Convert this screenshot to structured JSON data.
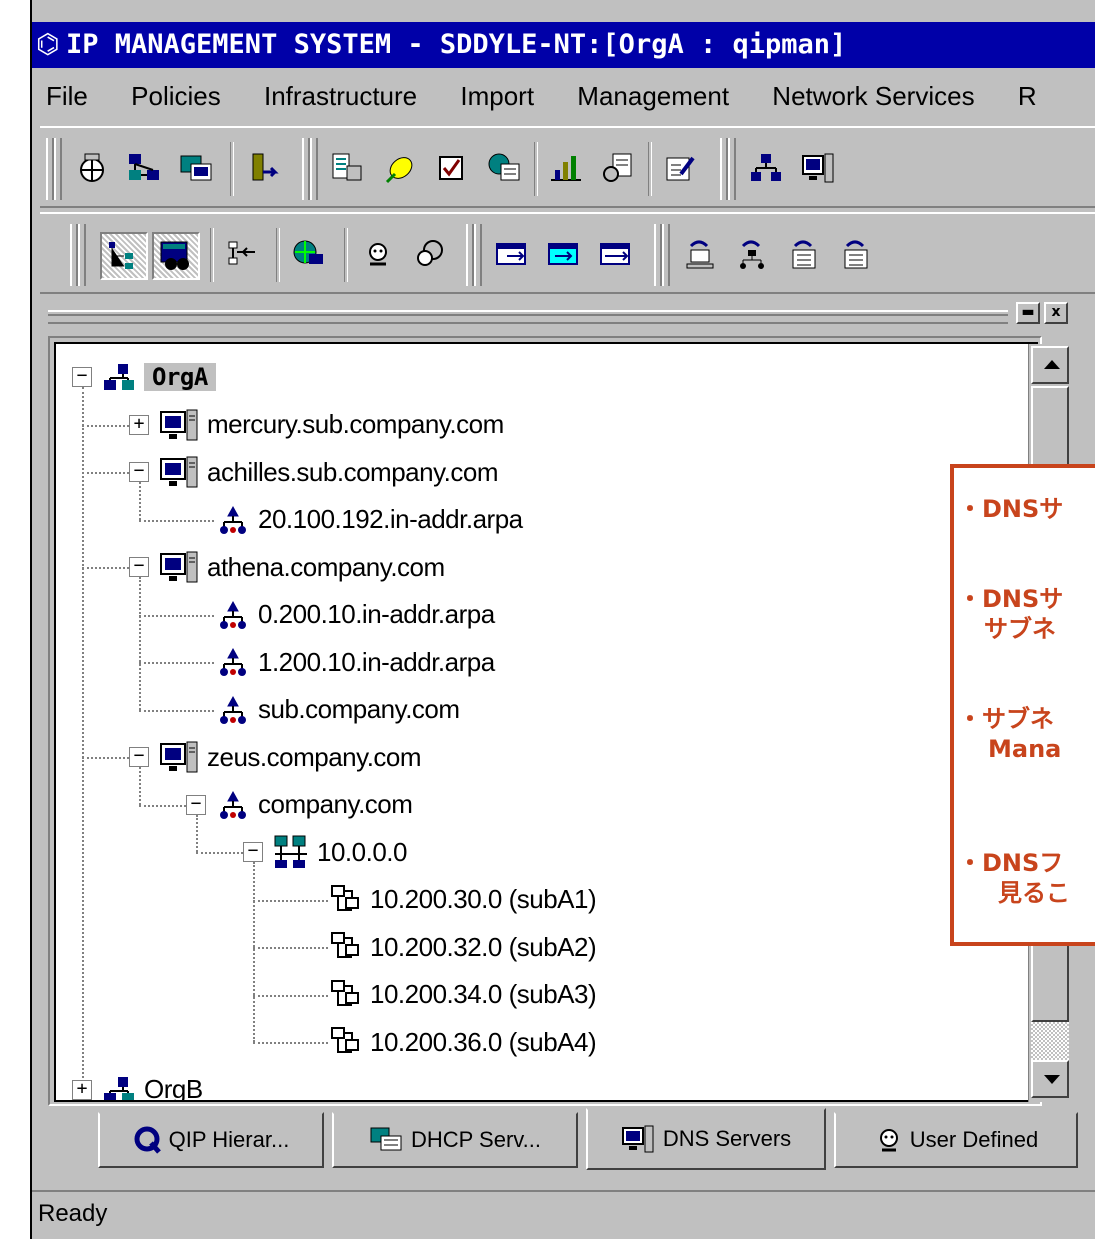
{
  "window": {
    "title": "IP MANAGEMENT SYSTEM - SDDYLE-NT:[OrgA : qipman]"
  },
  "menu": {
    "items": [
      "File",
      "Policies",
      "Infrastructure",
      "Import",
      "Management",
      "Network Services",
      "R"
    ]
  },
  "tree": {
    "nodes": [
      {
        "label": "OrgA",
        "icon": "organization-icon",
        "expander": "minus",
        "selected": true
      },
      {
        "label": "mercury.sub.company.com",
        "icon": "dns-server-icon",
        "expander": "plus"
      },
      {
        "label": "achilles.sub.company.com",
        "icon": "dns-server-icon",
        "expander": "minus"
      },
      {
        "label": "20.100.192.in-addr.arpa",
        "icon": "zone-icon"
      },
      {
        "label": "athena.company.com",
        "icon": "dns-server-icon",
        "expander": "minus"
      },
      {
        "label": "0.200.10.in-addr.arpa",
        "icon": "zone-icon"
      },
      {
        "label": "1.200.10.in-addr.arpa",
        "icon": "zone-icon"
      },
      {
        "label": "sub.company.com",
        "icon": "zone-icon"
      },
      {
        "label": "zeus.company.com",
        "icon": "dns-server-icon",
        "expander": "minus"
      },
      {
        "label": "company.com",
        "icon": "zone-icon",
        "expander": "minus"
      },
      {
        "label": "10.0.0.0",
        "icon": "network-icon",
        "expander": "minus"
      },
      {
        "label": "10.200.30.0 (subA1)",
        "icon": "subnet-icon"
      },
      {
        "label": "10.200.32.0 (subA2)",
        "icon": "subnet-icon"
      },
      {
        "label": "10.200.34.0 (subA3)",
        "icon": "subnet-icon"
      },
      {
        "label": "10.200.36.0 (subA4)",
        "icon": "subnet-icon"
      },
      {
        "label": "OrgB",
        "icon": "organization-icon",
        "expander": "plus"
      }
    ]
  },
  "tabs": [
    {
      "label": "QIP Hierar...",
      "icon": "q-logo-icon"
    },
    {
      "label": "DHCP Serv...",
      "icon": "dhcp-server-icon"
    },
    {
      "label": "DNS Servers",
      "icon": "dns-server-icon",
      "active": true
    },
    {
      "label": "User Defined",
      "icon": "user-icon"
    }
  ],
  "status": {
    "text": "Ready"
  },
  "callout": {
    "lines": [
      "・DNSサ",
      "・DNSサ",
      "サブネ",
      "・サブネ",
      "Mana",
      "・DNSフ",
      "見るこ"
    ],
    "color": "#c8441c"
  },
  "colors": {
    "titlebar": "#0000a8",
    "chrome": "#c0c0c0"
  }
}
